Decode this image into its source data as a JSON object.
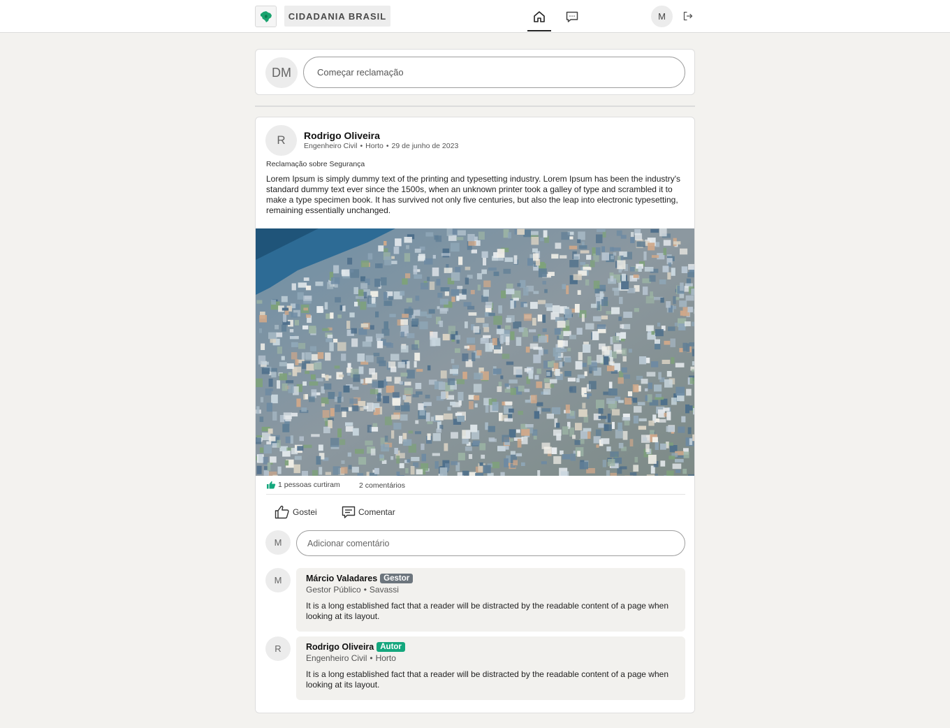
{
  "header": {
    "brand": "CIDADANIA BRASIL",
    "user_initial": "M",
    "icons": [
      "brazil-map-logo",
      "home-icon",
      "chat-icon",
      "logout-icon"
    ]
  },
  "composer": {
    "avatar_initials": "DM",
    "placeholder": "Começar reclamação"
  },
  "post": {
    "avatar_initial": "R",
    "author": "Rodrigo Oliveira",
    "role": "Engenheiro Civil",
    "location": "Horto",
    "date": "29 de junho de 2023",
    "subject": "Reclamação sobre Segurança",
    "body": "Lorem Ipsum is simply dummy text of the printing and typesetting industry. Lorem Ipsum has been the industry's standard dummy text ever since the 1500s, when an unknown printer took a galley of type and scrambled it to make a type specimen book. It has survived not only five centuries, but also the leap into electronic typesetting, remaining essentially unchanged.",
    "likes_text": "1 pessoas curtiram",
    "comments_text": "2 comentários",
    "like_label": "Gostei",
    "comment_label": "Comentar",
    "comment_input": {
      "avatar_initial": "M",
      "placeholder": "Adicionar comentário"
    },
    "comments": [
      {
        "avatar_initial": "M",
        "name": "Márcio Valadares",
        "badge": "Gestor",
        "role": "Gestor Público",
        "location": "Savassi",
        "text": "It is a long established fact that a reader will be distracted by the readable content of a page when looking at its layout."
      },
      {
        "avatar_initial": "R",
        "name": "Rodrigo Oliveira",
        "badge": "Autor",
        "role": "Engenheiro Civil",
        "location": "Horto",
        "text": "It is a long established fact that a reader will be distracted by the readable content of a page when looking at its layout."
      }
    ]
  },
  "colors": {
    "page_bg": "#f3f2ef",
    "badge_gestor": "#6c757d",
    "badge_autor": "#14a77d",
    "brand_green": "#1aa36f"
  }
}
